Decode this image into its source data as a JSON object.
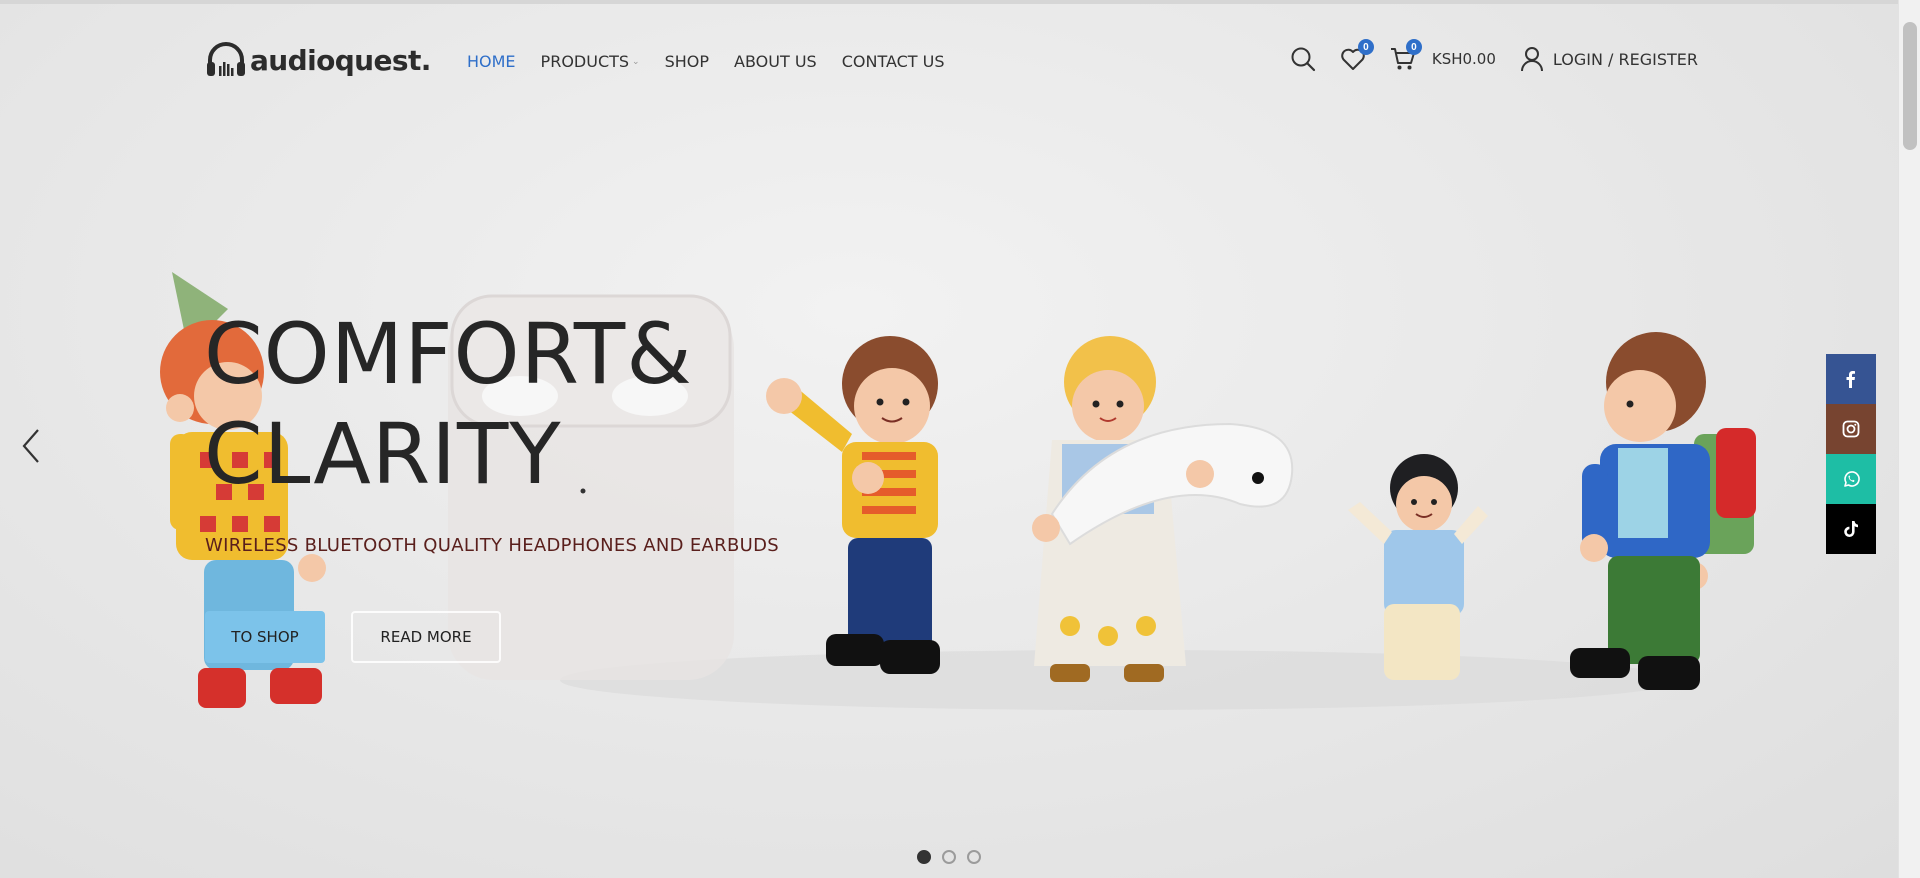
{
  "brand": {
    "name": "audioquest."
  },
  "nav": {
    "items": [
      {
        "label": "HOME",
        "active": true
      },
      {
        "label": "PRODUCTS",
        "has_dropdown": true
      },
      {
        "label": "SHOP"
      },
      {
        "label": "ABOUT US"
      },
      {
        "label": "CONTACT US"
      }
    ]
  },
  "header_tools": {
    "search_icon": "search-icon",
    "wishlist": {
      "icon": "heart-icon",
      "count": "0"
    },
    "cart": {
      "icon": "cart-icon",
      "count": "0",
      "total": "KSH0.00"
    },
    "login": {
      "icon": "user-icon",
      "label": "LOGIN / REGISTER"
    }
  },
  "hero": {
    "title": "COMFORT&\nCLARITY",
    "subtitle": "WIRELESS BLUETOOTH QUALITY HEADPHONES AND EARBUDS",
    "buttons": {
      "shop": "TO SHOP",
      "read_more": "READ MORE"
    },
    "slide_count": 3,
    "active_slide": 1
  },
  "social": [
    {
      "name": "facebook-icon",
      "color": "#365493"
    },
    {
      "name": "instagram-icon",
      "color": "#774430"
    },
    {
      "name": "whatsapp-icon",
      "color": "#1ebea5"
    },
    {
      "name": "tiktok-icon",
      "color": "#000000"
    }
  ],
  "colors": {
    "accent": "#2f6fc9",
    "shop_button": "#7cc3ea",
    "subtitle": "#5a1f1c"
  }
}
